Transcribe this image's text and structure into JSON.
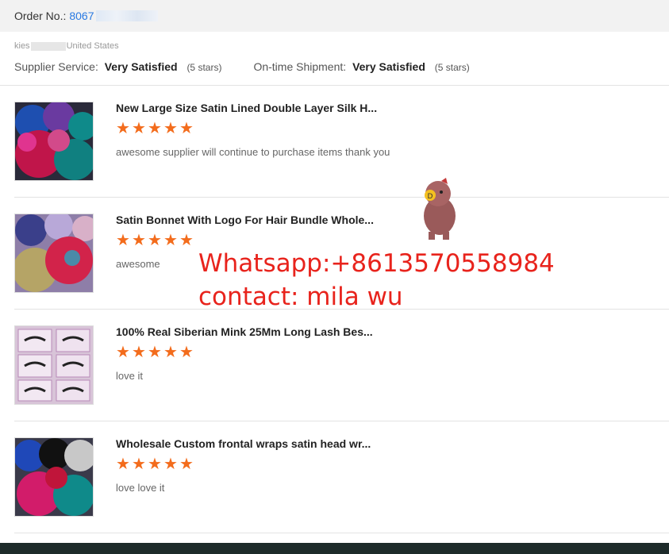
{
  "order": {
    "label": "Order No.:",
    "number": "8067"
  },
  "buyer": {
    "name": "kies",
    "country": "United States"
  },
  "ratings": [
    {
      "label": "Supplier Service:",
      "value": "Very Satisfied",
      "stars": "(5 stars)"
    },
    {
      "label": "On-time Shipment:",
      "value": "Very Satisfied",
      "stars": "(5 stars)"
    }
  ],
  "reviews": [
    {
      "title": "New Large Size Satin Lined Double Layer Silk H...",
      "rating": 5,
      "comment": "awesome supplier will continue to purchase items thank you",
      "thumb": "satin-bonnets"
    },
    {
      "title": "Satin Bonnet With Logo For Hair Bundle Whole...",
      "rating": 5,
      "comment": "awesome",
      "thumb": "satin-bonnets"
    },
    {
      "title": "100% Real Siberian Mink 25Mm Long Lash Bes...",
      "rating": 5,
      "comment": "love it",
      "thumb": "lash-boxes"
    },
    {
      "title": "Wholesale Custom frontal wraps satin head wr...",
      "rating": 5,
      "comment": "love love it",
      "thumb": "satin-bonnets"
    }
  ],
  "watermark": {
    "line1": "Whatsapp:+8613570558984",
    "line2": "contact: mila wu"
  },
  "colors": {
    "star": "#f36c1c",
    "link": "#2a7ae2",
    "watermark": "#e8231c"
  }
}
